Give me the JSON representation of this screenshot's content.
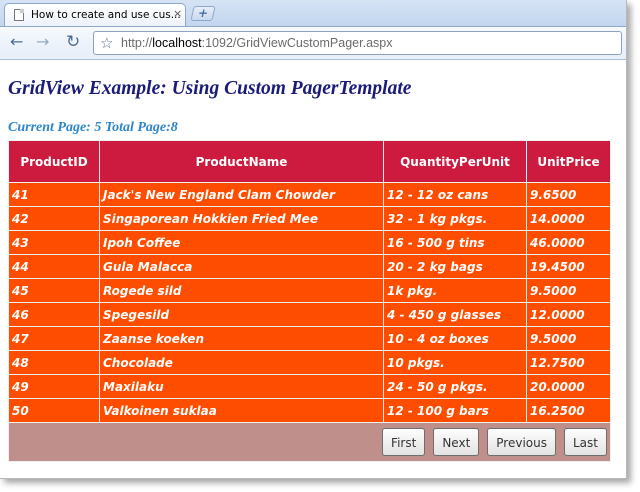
{
  "browser": {
    "tab_title": "How to create and use cus...",
    "tab_close": "×",
    "new_tab": "+",
    "url_prefix": "http://",
    "url_host": "localhost",
    "url_rest": ":1092/GridViewCustomPager.aspx",
    "back": "←",
    "forward": "→",
    "reload": "↻",
    "star": "☆"
  },
  "page": {
    "title": "GridView Example: Using Custom PagerTemplate",
    "info": "Current Page: 5 Total Page:8"
  },
  "grid": {
    "headers": [
      "ProductID",
      "ProductName",
      "QuantityPerUnit",
      "UnitPrice"
    ],
    "rows": [
      [
        "41",
        "Jack's New England Clam Chowder",
        "12 - 12 oz cans",
        "9.6500"
      ],
      [
        "42",
        "Singaporean Hokkien Fried Mee",
        "32 - 1 kg pkgs.",
        "14.0000"
      ],
      [
        "43",
        "Ipoh Coffee",
        "16 - 500 g tins",
        "46.0000"
      ],
      [
        "44",
        "Gula Malacca",
        "20 - 2 kg bags",
        "19.4500"
      ],
      [
        "45",
        "Rogede sild",
        "1k pkg.",
        "9.5000"
      ],
      [
        "46",
        "Spegesild",
        "4 - 450 g glasses",
        "12.0000"
      ],
      [
        "47",
        "Zaanse koeken",
        "10 - 4 oz boxes",
        "9.5000"
      ],
      [
        "48",
        "Chocolade",
        "10 pkgs.",
        "12.7500"
      ],
      [
        "49",
        "Maxilaku",
        "24 - 50 g pkgs.",
        "20.0000"
      ],
      [
        "50",
        "Valkoinen suklaa",
        "12 - 100 g bars",
        "16.2500"
      ]
    ],
    "pager": {
      "first": "First",
      "next": "Next",
      "previous": "Previous",
      "last": "Last"
    }
  },
  "colors": {
    "header_bg": "#cc1b3e",
    "row_bg": "#ff4d00",
    "pager_bg": "#bf8f8b",
    "title": "#1b1b7a",
    "info": "#2e86c8"
  }
}
